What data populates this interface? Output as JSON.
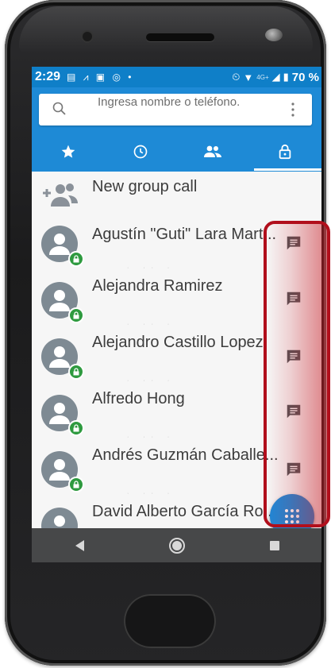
{
  "status_bar": {
    "time": "2:29",
    "notification_icons": "▤ ⩘ ▣ ◎ •",
    "network": "4G+",
    "battery_percent": "70 %"
  },
  "search": {
    "placeholder": "Ingresa nombre o teléfono."
  },
  "tabs": [
    {
      "icon": "star-icon",
      "active": false
    },
    {
      "icon": "clock-icon",
      "active": false
    },
    {
      "icon": "contacts-icon",
      "active": false
    },
    {
      "icon": "lock-icon",
      "active": true
    }
  ],
  "new_group": {
    "label": "New group call"
  },
  "contacts": [
    {
      "name": "Agustín \"Guti\" Lara Mart..."
    },
    {
      "name": "Alejandra Ramirez"
    },
    {
      "name": "Alejandro Castillo Lopez"
    },
    {
      "name": "Alfredo Hong"
    },
    {
      "name": "Andrés Guzmán Caballe..."
    },
    {
      "name": "David Alberto García Ro..."
    }
  ],
  "separator_text": "· ·· ·",
  "colors": {
    "status_bar": "#0f7fc8",
    "app_bar": "#1e8ad6",
    "avatar": "#7e8a93",
    "lock_badge": "#2e9a3f",
    "fab": "#1e88d8",
    "highlight": "#b10f1c",
    "nav_bar": "#474849"
  }
}
